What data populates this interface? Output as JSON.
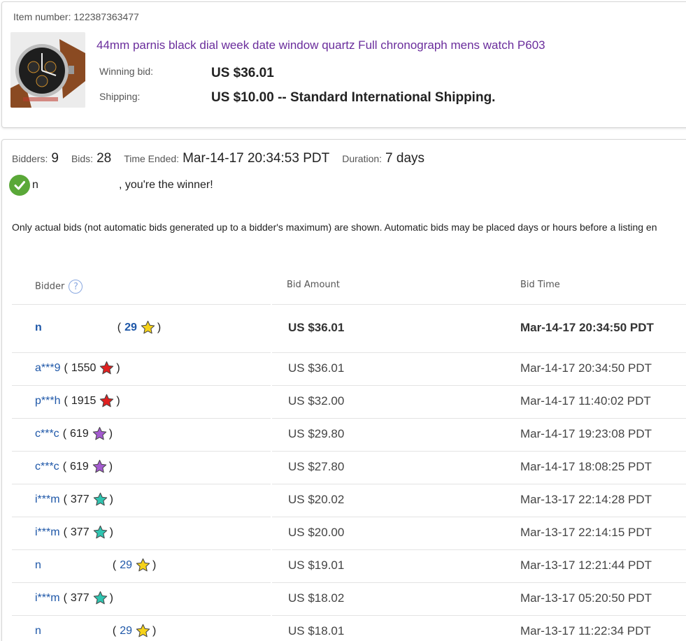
{
  "item": {
    "number_label": "Item number: 122387363477",
    "title": "44mm parnis black dial week date window quartz Full chronograph mens watch P603",
    "winning_bid_label": "Winning bid:",
    "winning_bid_value": "US $36.01",
    "shipping_label": "Shipping:",
    "shipping_value": "US $10.00 -- Standard International Shipping."
  },
  "summary": {
    "bidders_label": "Bidders:",
    "bidders_value": "9",
    "bids_label": "Bids:",
    "bids_value": "28",
    "ended_label": "Time Ended:",
    "ended_value": "Mar-14-17 20:34:53 PDT",
    "duration_label": "Duration:",
    "duration_value": "7 days"
  },
  "winner": {
    "name": "n",
    "message": ", you're the winner!"
  },
  "note": "Only actual bids (not automatic bids generated up to a bidder's maximum) are shown. Automatic bids may be placed days or hours before a listing en",
  "table": {
    "headers": {
      "bidder": "Bidder",
      "help": "?",
      "amount": "Bid Amount",
      "time": "Bid Time"
    },
    "rows": [
      {
        "bidder": "n",
        "open": "(",
        "score": "29",
        "close": ")",
        "star": "yellow-star-icon",
        "amount": "US $36.01",
        "time": "Mar-14-17 20:34:50 PDT"
      },
      {
        "bidder": "a***9",
        "open": "(",
        "score": "1550",
        "close": ")",
        "star": "red-star-icon",
        "amount": "US $36.01",
        "time": "Mar-14-17 20:34:50 PDT"
      },
      {
        "bidder": "p***h",
        "open": "(",
        "score": "1915",
        "close": ")",
        "star": "red-star-icon",
        "amount": "US $32.00",
        "time": "Mar-14-17 11:40:02 PDT"
      },
      {
        "bidder": "c***c",
        "open": "(",
        "score": "619",
        "close": ")",
        "star": "purple-star-icon",
        "amount": "US $29.80",
        "time": "Mar-14-17 19:23:08 PDT"
      },
      {
        "bidder": "c***c",
        "open": "(",
        "score": "619",
        "close": ")",
        "star": "purple-star-icon",
        "amount": "US $27.80",
        "time": "Mar-14-17 18:08:25 PDT"
      },
      {
        "bidder": "i***m",
        "open": "(",
        "score": "377",
        "close": ")",
        "star": "teal-star-icon",
        "amount": "US $20.02",
        "time": "Mar-13-17 22:14:28 PDT"
      },
      {
        "bidder": "i***m",
        "open": "(",
        "score": "377",
        "close": ")",
        "star": "teal-star-icon",
        "amount": "US $20.00",
        "time": "Mar-13-17 22:14:15 PDT"
      },
      {
        "bidder": "n",
        "open": "(",
        "score": "29",
        "close": ")",
        "star": "yellow-star-icon",
        "amount": "US $19.01",
        "time": "Mar-13-17 12:21:44 PDT"
      },
      {
        "bidder": "i***m",
        "open": "(",
        "score": "377",
        "close": ")",
        "star": "teal-star-icon",
        "amount": "US $18.02",
        "time": "Mar-13-17 05:20:50 PDT"
      },
      {
        "bidder": "n",
        "open": "(",
        "score": "29",
        "close": ")",
        "star": "yellow-star-icon",
        "amount": "US $18.01",
        "time": "Mar-13-17 11:22:34 PDT"
      }
    ]
  },
  "colors": {
    "link_purple": "#6a2d9c",
    "link_blue": "#1e57a8",
    "check_green": "#5aa838",
    "star_yellow": "#f6d219",
    "star_red": "#e02020",
    "star_purple": "#a45bd0",
    "star_teal": "#2fc4b0"
  }
}
